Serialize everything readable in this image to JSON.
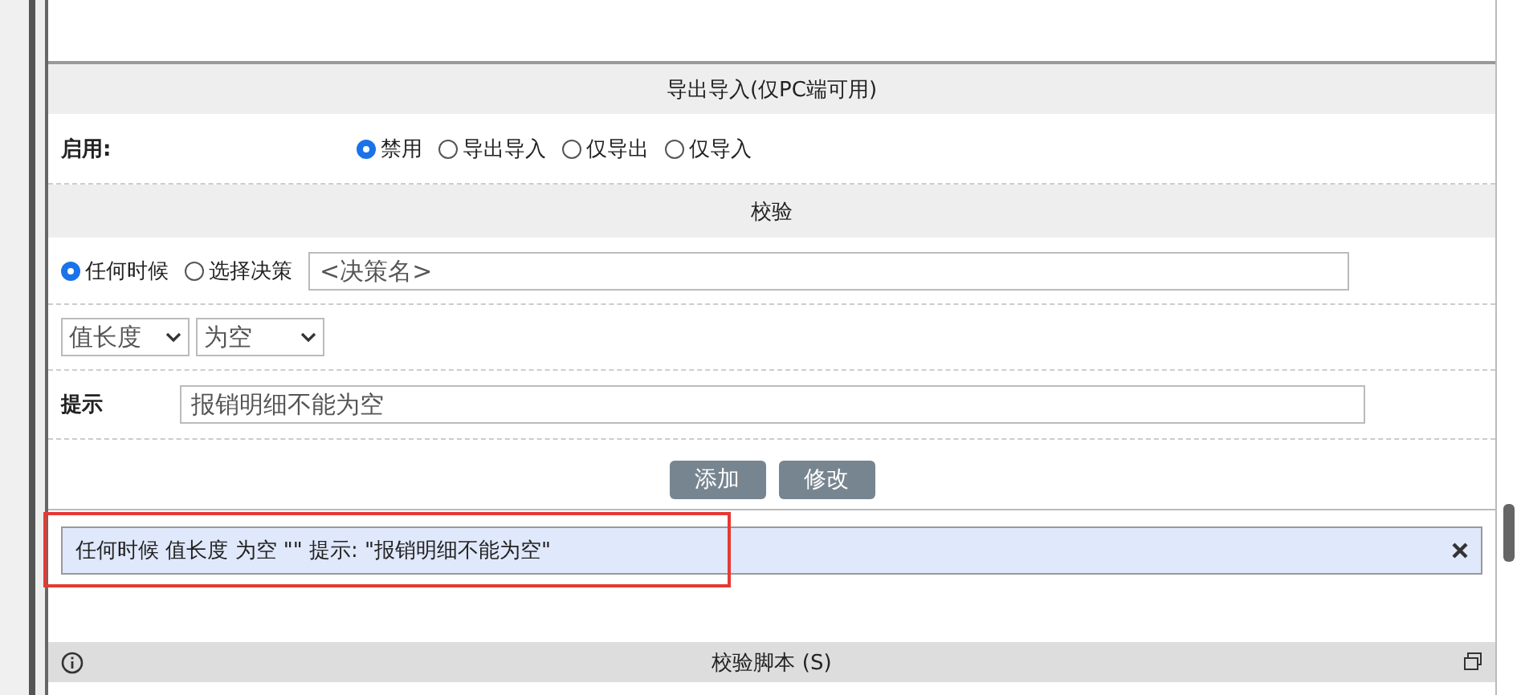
{
  "export_section": {
    "title": "导出导入(仅PC端可用)",
    "enable_label": "启用:",
    "options": [
      {
        "label": "禁用",
        "selected": true
      },
      {
        "label": "导出导入",
        "selected": false
      },
      {
        "label": "仅导出",
        "selected": false
      },
      {
        "label": "仅导入",
        "selected": false
      }
    ]
  },
  "validation_section": {
    "title": "校验",
    "timing_options": [
      {
        "label": "任何时候",
        "selected": true
      },
      {
        "label": "选择决策",
        "selected": false
      }
    ],
    "decision_field": {
      "placeholder": "<决策名>"
    },
    "field_select": {
      "value": "值长度"
    },
    "condition_select": {
      "value": "为空"
    },
    "hint_label": "提示",
    "hint_field": {
      "value": "报销明细不能为空"
    },
    "buttons": [
      "添加",
      "修改"
    ],
    "rules": [
      {
        "text": "任何时候 值长度 为空 \"\" 提示: \"报销明细不能为空\"",
        "highlighted": true
      }
    ]
  },
  "script_section": {
    "title": "校验脚本 (S)"
  }
}
